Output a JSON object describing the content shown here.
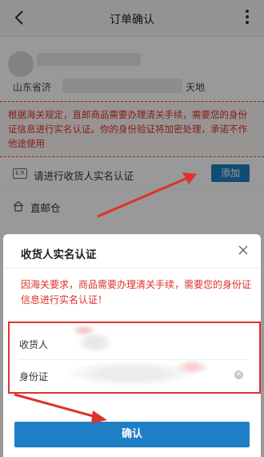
{
  "header": {
    "title": "订单确认"
  },
  "address": {
    "province_prefix": "山东省济",
    "suffix": "天地"
  },
  "notice": {
    "text": "根据海关规定，直邮商品需要办理清关手续，需要您的身份证信息进行实名认证。你的身份验证将加密处理，承诺不作他途使用"
  },
  "verify_row": {
    "icon_text": "E.R",
    "label": "请进行收货人实名认证",
    "add_button": "添加"
  },
  "direct_row": {
    "label": "直邮仓"
  },
  "sheet": {
    "title": "收货人实名认证",
    "message": "因海关要求，商品需要办理清关手续，需要您的身份证信息进行实名认证！",
    "fields": [
      {
        "label": "收货人",
        "value": ""
      },
      {
        "label": "身份证",
        "value": ""
      }
    ],
    "confirm_button": "确认"
  },
  "colors": {
    "accent": "#1f7fc4",
    "warning": "#d9322a",
    "highlight_box": "#e0312b"
  },
  "icons": [
    "back-arrow-icon",
    "more-vertical-icon",
    "id-card-icon",
    "home-icon",
    "close-icon",
    "clear-icon"
  ]
}
